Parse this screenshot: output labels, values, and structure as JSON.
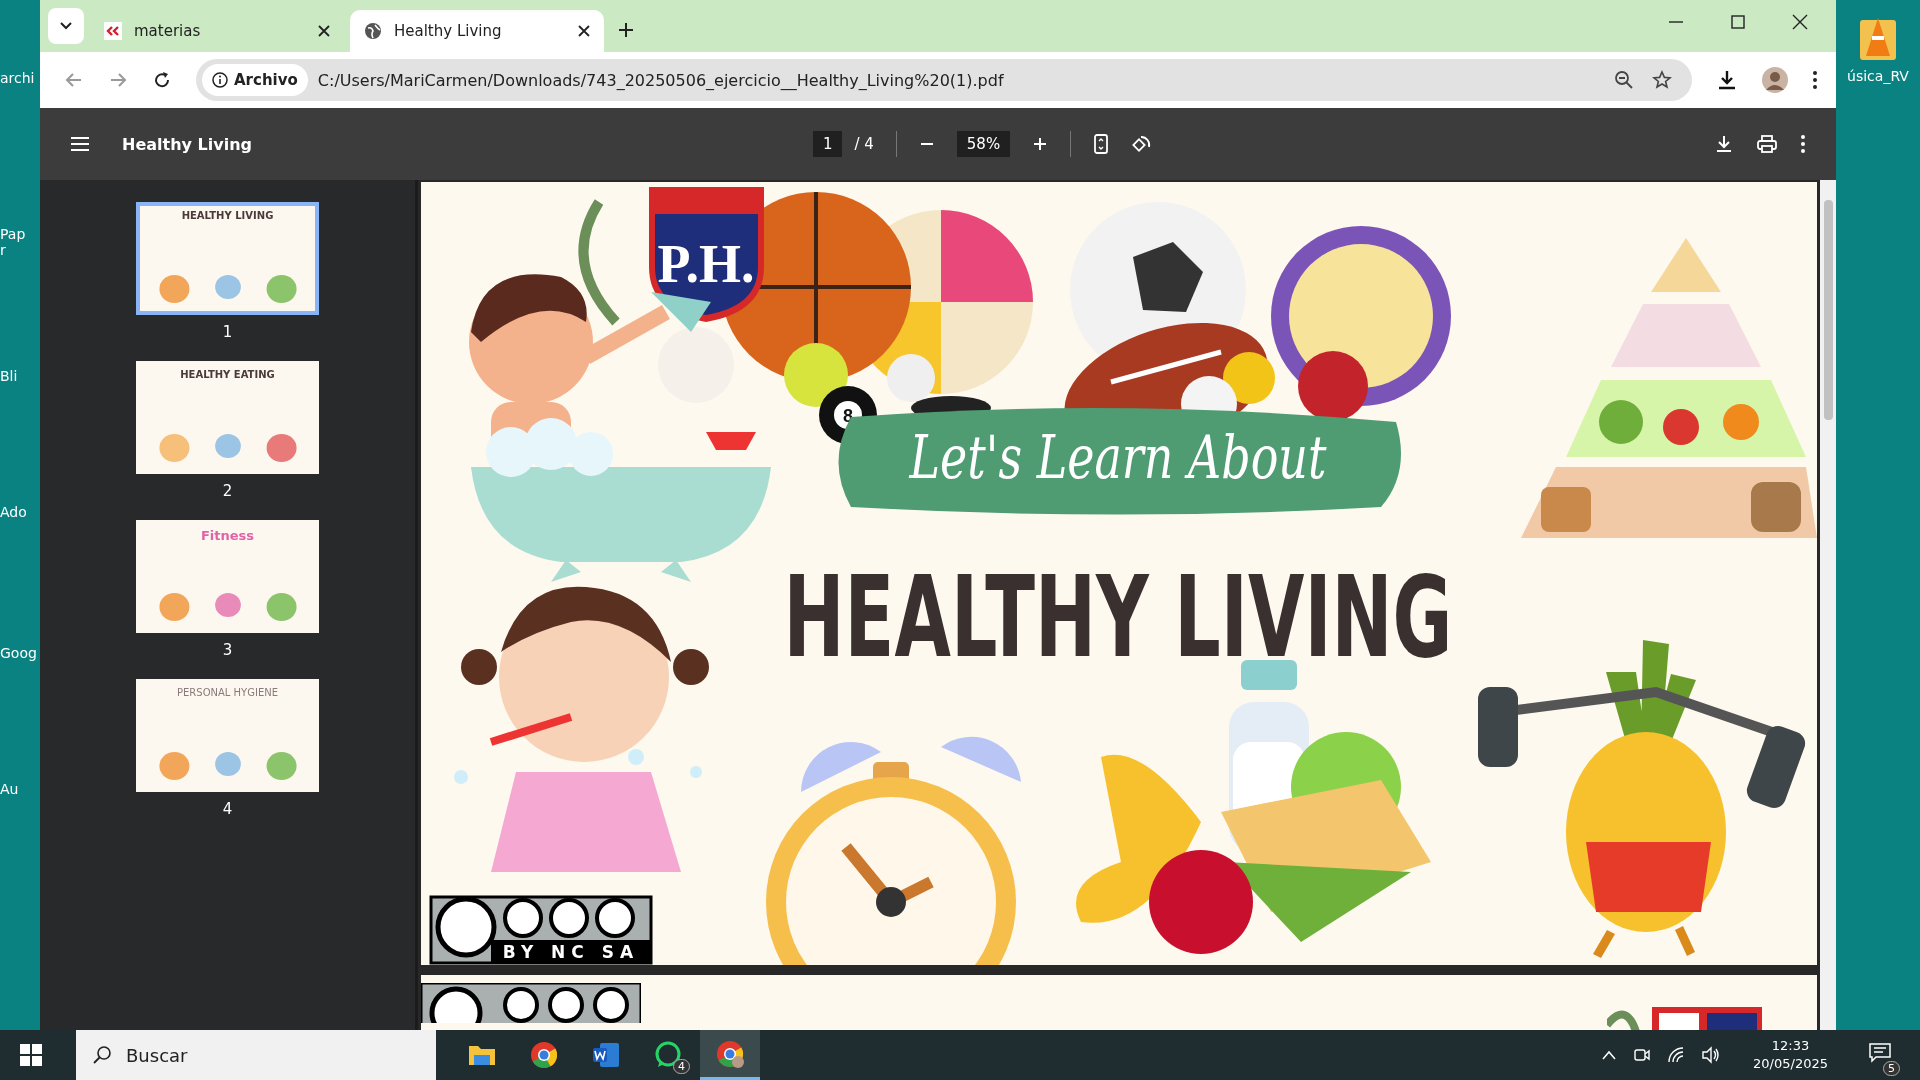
{
  "desktop": {
    "left_labels": [
      "archi",
      "Pap",
      "r",
      "Bli",
      "Ado",
      "Goog",
      "Au"
    ],
    "right_label": "úsica_RV"
  },
  "tabs": [
    {
      "title": "materias",
      "selected": false,
      "kind": "site"
    },
    {
      "title": "Healthy Living",
      "selected": true,
      "kind": "globe"
    }
  ],
  "address_bar": {
    "badge": "Archivo",
    "url": "C:/Users/MariCarmen/Downloads/743_20250506_ejercicio__Healthy_Living%20(1).pdf"
  },
  "pdf_toolbar": {
    "title": "Healthy Living",
    "page": "1",
    "page_total": "/ 4",
    "zoom": "58%"
  },
  "thumbnails": [
    {
      "number": "1",
      "title": "HEALTHY LIVING",
      "selected": true
    },
    {
      "number": "2",
      "title": "HEALTHY EATING",
      "selected": false
    },
    {
      "number": "3",
      "title": "Fitness",
      "selected": false
    },
    {
      "number": "4",
      "title": "PERSONAL HYGIENE",
      "selected": false
    }
  ],
  "slide": {
    "logo": "P.H.",
    "banner": "Let's Learn About",
    "heading": "HEALTHY LIVING",
    "license": "BY NC SA",
    "ball_number": "8"
  },
  "taskbar": {
    "search_placeholder": "Buscar",
    "apps": [
      {
        "kind": "folder",
        "selected": false
      },
      {
        "kind": "chrome",
        "selected": false
      },
      {
        "kind": "word",
        "selected": false
      },
      {
        "kind": "whatsapp",
        "selected": false,
        "badge": "4"
      },
      {
        "kind": "chrome-profile",
        "selected": true
      }
    ],
    "time": "12:33",
    "date": "20/05/2025",
    "notifications": "5"
  }
}
